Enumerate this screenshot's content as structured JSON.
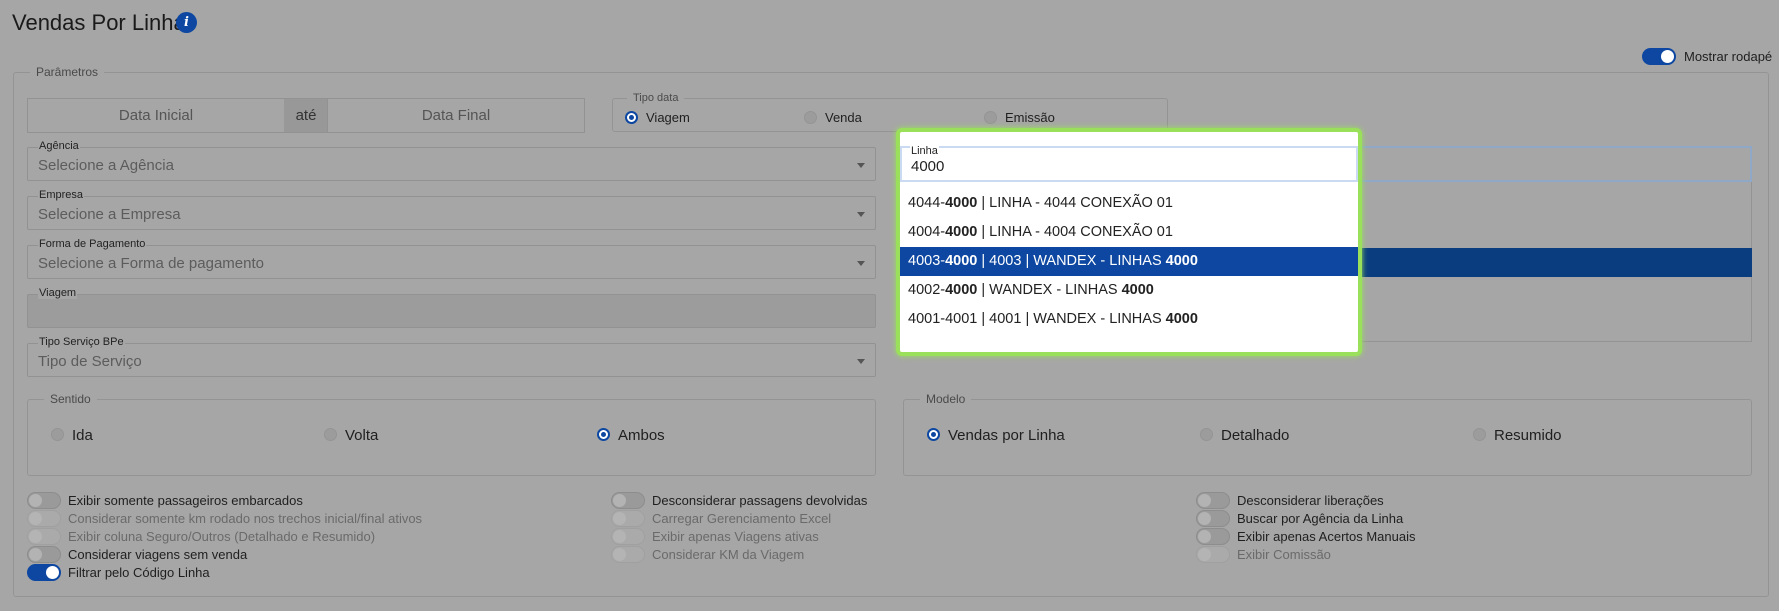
{
  "header": {
    "title": "Vendas Por Linha",
    "info_icon": "info-icon",
    "info_glyph": "i"
  },
  "footer_toggle": {
    "label": "Mostrar rodapé",
    "on": true
  },
  "params": {
    "legend": "Parâmetros"
  },
  "dates": {
    "start_placeholder": "Data Inicial",
    "separator": "até",
    "end_placeholder": "Data Final"
  },
  "tipo_data": {
    "legend": "Tipo data",
    "options": [
      "Viagem",
      "Venda",
      "Emissão"
    ],
    "selected": "Viagem"
  },
  "fields": {
    "agencia": {
      "label": "Agência",
      "placeholder": "Selecione a Agência"
    },
    "empresa": {
      "label": "Empresa",
      "placeholder": "Selecione a Empresa"
    },
    "forma_pagamento": {
      "label": "Forma de Pagamento",
      "placeholder": "Selecione a Forma de pagamento"
    },
    "viagem": {
      "label": "Viagem",
      "placeholder": ""
    },
    "tipo_servico": {
      "label": "Tipo Serviço BPe",
      "placeholder": "Tipo de Serviço"
    }
  },
  "linha": {
    "label": "Linha",
    "value": "4000",
    "options": [
      {
        "parts": [
          [
            "4044-",
            false
          ],
          [
            "4000",
            true
          ],
          [
            " | LINHA - 4044 CONEXÃO 01",
            false
          ]
        ],
        "selected": false
      },
      {
        "parts": [
          [
            "4004-",
            false
          ],
          [
            "4000",
            true
          ],
          [
            " | LINHA - 4004 CONEXÃO 01",
            false
          ]
        ],
        "selected": false
      },
      {
        "parts": [
          [
            "4003-",
            false
          ],
          [
            "4000",
            true
          ],
          [
            " | 4003 | WANDEX - LINHAS ",
            false
          ],
          [
            "4000",
            true
          ]
        ],
        "selected": true
      },
      {
        "parts": [
          [
            "4002-",
            false
          ],
          [
            "4000",
            true
          ],
          [
            " | WANDEX - LINHAS ",
            false
          ],
          [
            "4000",
            true
          ]
        ],
        "selected": false
      },
      {
        "parts": [
          [
            "4001-4001 | 4001 | WANDEX - LINHAS ",
            false
          ],
          [
            "4000",
            true
          ]
        ],
        "selected": false
      }
    ]
  },
  "sentido": {
    "legend": "Sentido",
    "options": [
      "Ida",
      "Volta",
      "Ambos"
    ],
    "selected": "Ambos"
  },
  "modelo": {
    "legend": "Modelo",
    "options": [
      "Vendas por Linha",
      "Detalhado",
      "Resumido"
    ],
    "selected": "Vendas por Linha"
  },
  "toggles": {
    "col1": [
      {
        "label": "Exibir somente passageiros embarcados",
        "on": false,
        "dim": false
      },
      {
        "label": "Considerar somente km rodado nos trechos inicial/final ativos",
        "on": false,
        "dim": true
      },
      {
        "label": "Exibir coluna Seguro/Outros (Detalhado e Resumido)",
        "on": false,
        "dim": true
      },
      {
        "label": "Considerar viagens sem venda",
        "on": false,
        "dim": false
      },
      {
        "label": "Filtrar pelo Código Linha",
        "on": true,
        "dim": false
      }
    ],
    "col2": [
      {
        "label": "Desconsiderar passagens devolvidas",
        "on": false,
        "dim": false
      },
      {
        "label": "Carregar Gerenciamento Excel",
        "on": false,
        "dim": true
      },
      {
        "label": "Exibir apenas Viagens ativas",
        "on": false,
        "dim": true
      },
      {
        "label": "Considerar KM da Viagem",
        "on": false,
        "dim": true
      }
    ],
    "col3": [
      {
        "label": "Desconsiderar liberações",
        "on": false,
        "dim": false
      },
      {
        "label": "Buscar por Agência da Linha",
        "on": false,
        "dim": false
      },
      {
        "label": "Exibir apenas Acertos Manuais",
        "on": false,
        "dim": false
      },
      {
        "label": "Exibir Comissão",
        "on": false,
        "dim": true
      }
    ]
  },
  "colors": {
    "accent": "#0d47a1",
    "highlight": "#9ae05a",
    "overlay": "#a6a6a6"
  }
}
